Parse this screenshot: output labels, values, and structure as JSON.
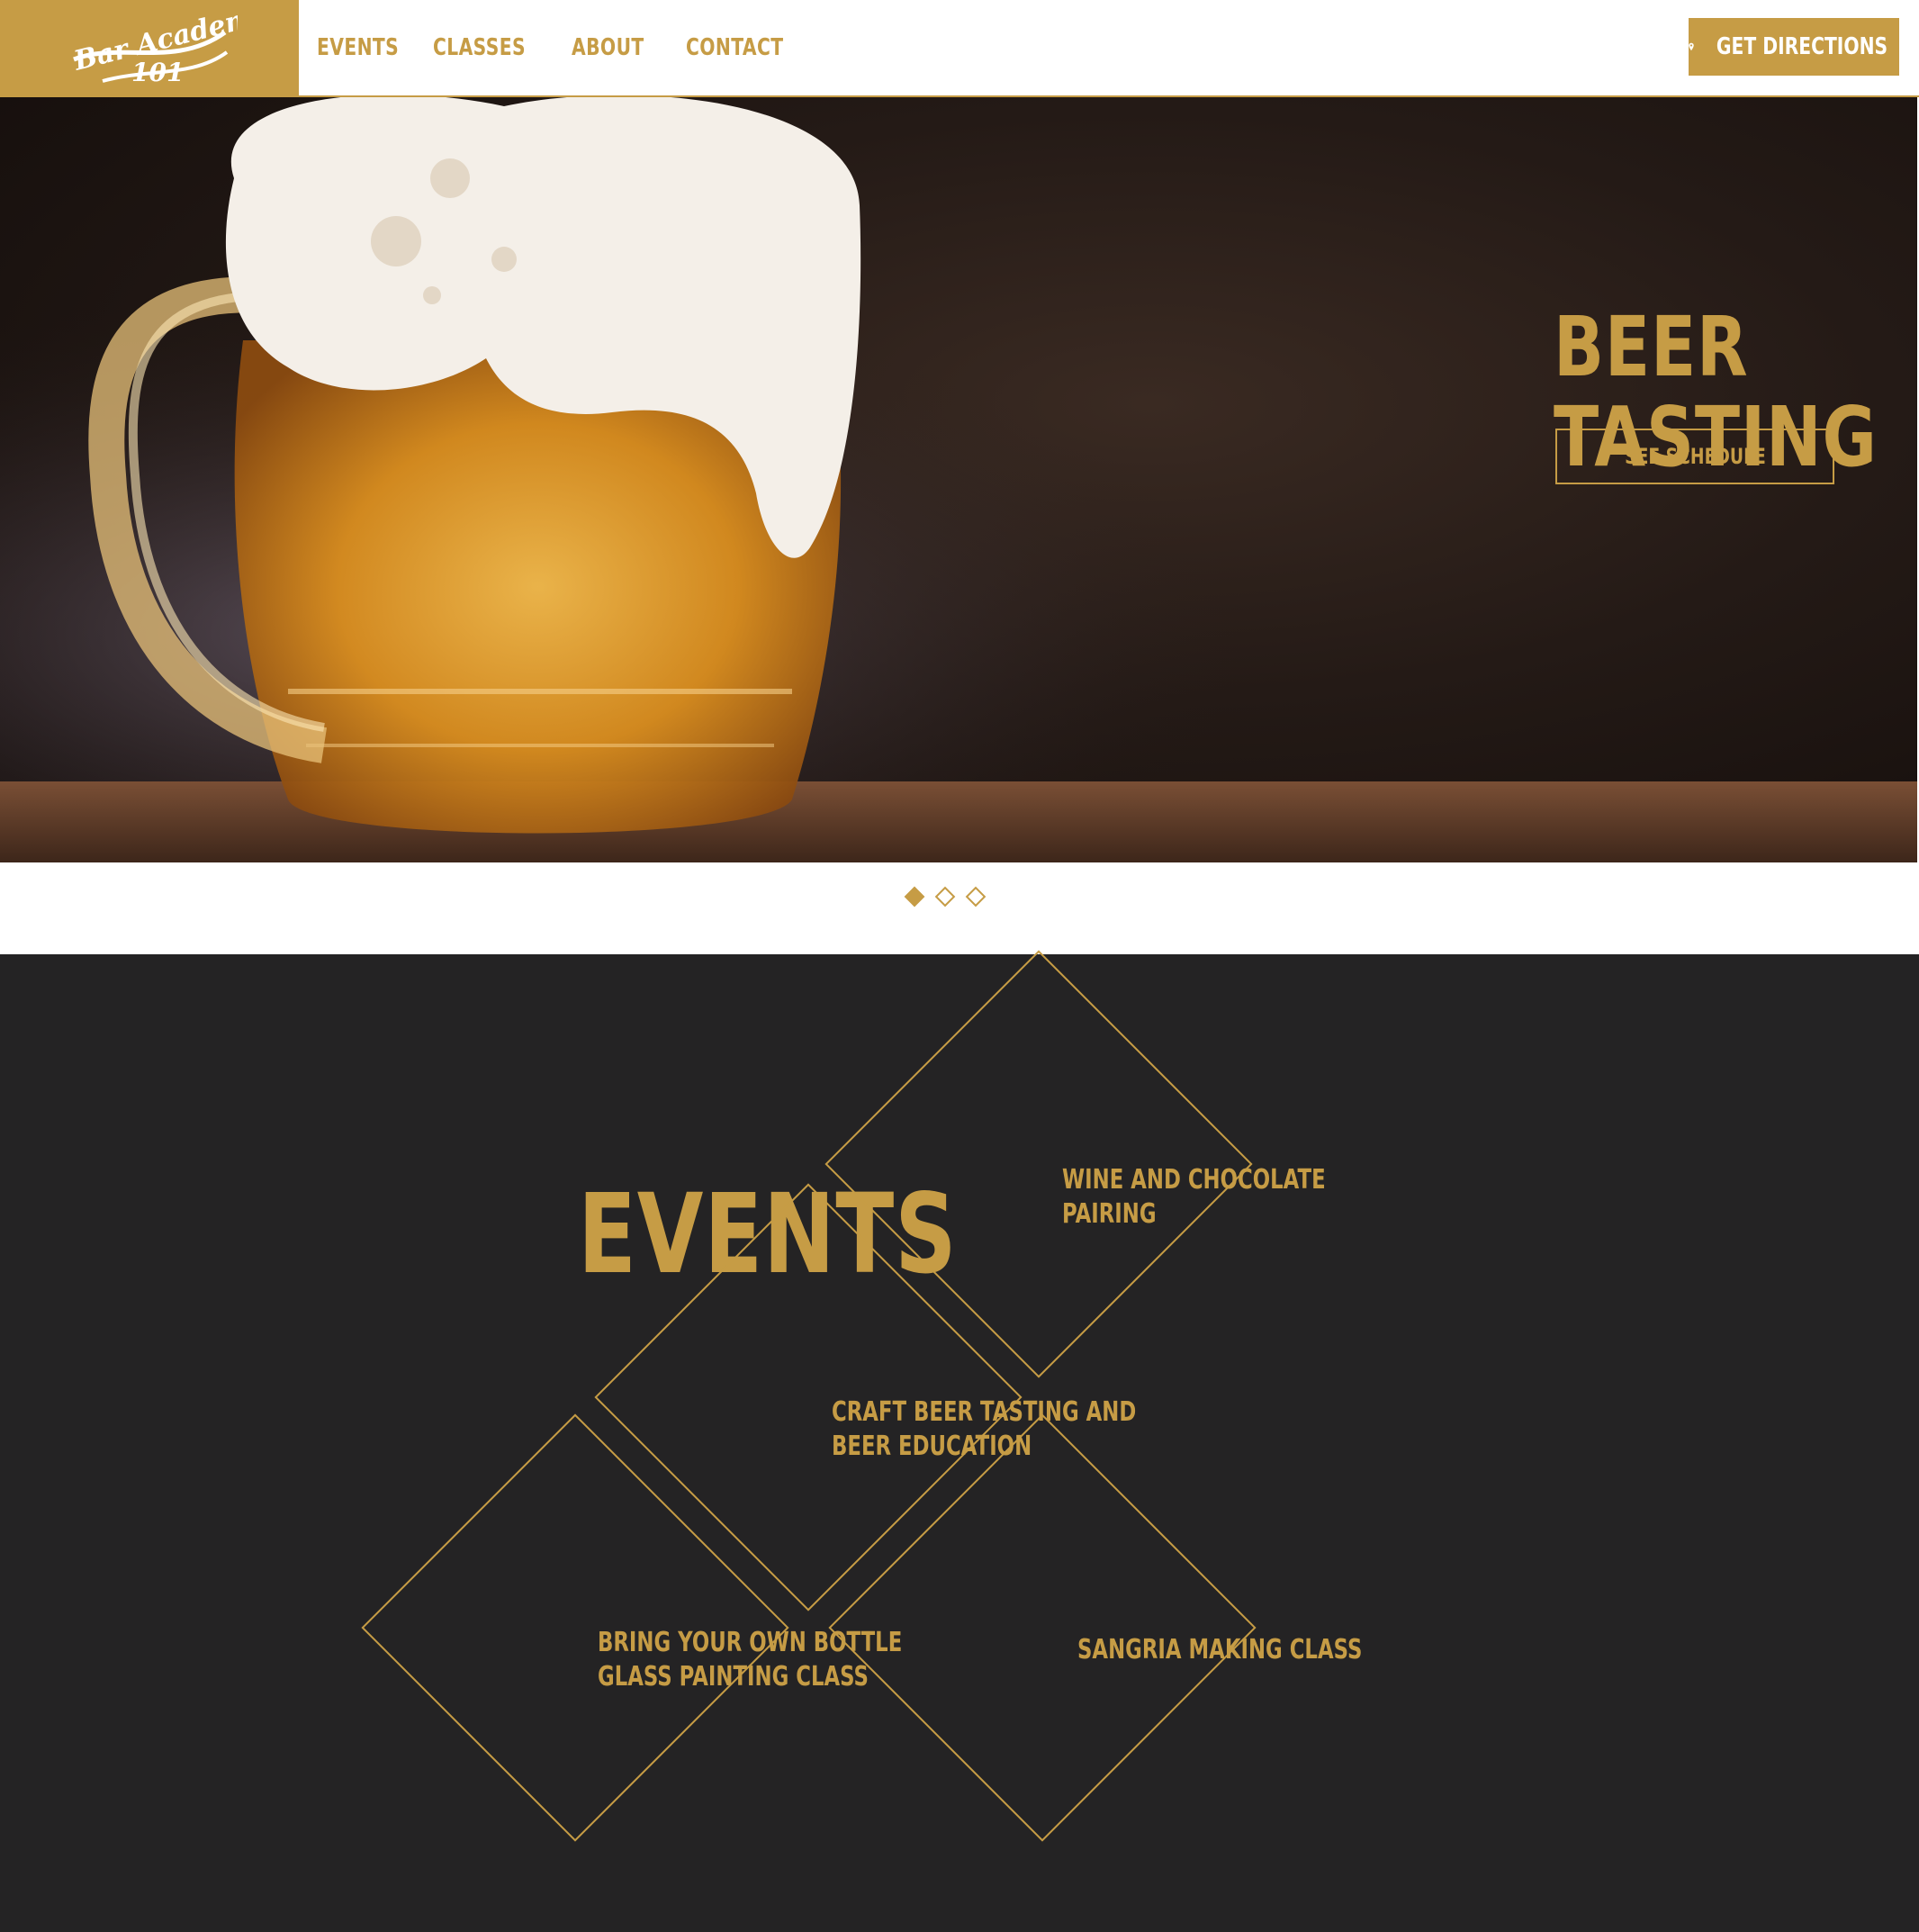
{
  "brand": {
    "logo_text_top": "Bar Academy",
    "logo_text_bottom": "101",
    "accent": "#c69c45",
    "dark": "#242324"
  },
  "nav": {
    "items": [
      {
        "label": "EVENTS"
      },
      {
        "label": "CLASSES"
      },
      {
        "label": "ABOUT"
      },
      {
        "label": "CONTACT"
      }
    ]
  },
  "header": {
    "directions_label": "GET DIRECTIONS",
    "directions_icon": "map-pin-icon"
  },
  "hero": {
    "title": "BEER\nTASTING",
    "button_label": "SEE SCHEDULE",
    "slide_count": 3,
    "active_slide": 1
  },
  "events": {
    "title": "EVENTS",
    "items": [
      {
        "label": "WINE AND CHOCOLATE\nPAIRING"
      },
      {
        "label": "CRAFT BEER TASTING AND\nBEER EDUCATION"
      },
      {
        "label": "BRING YOUR OWN BOTTLE\nGLASS PAINTING CLASS"
      },
      {
        "label": "SANGRIA MAKING CLASS"
      }
    ]
  }
}
